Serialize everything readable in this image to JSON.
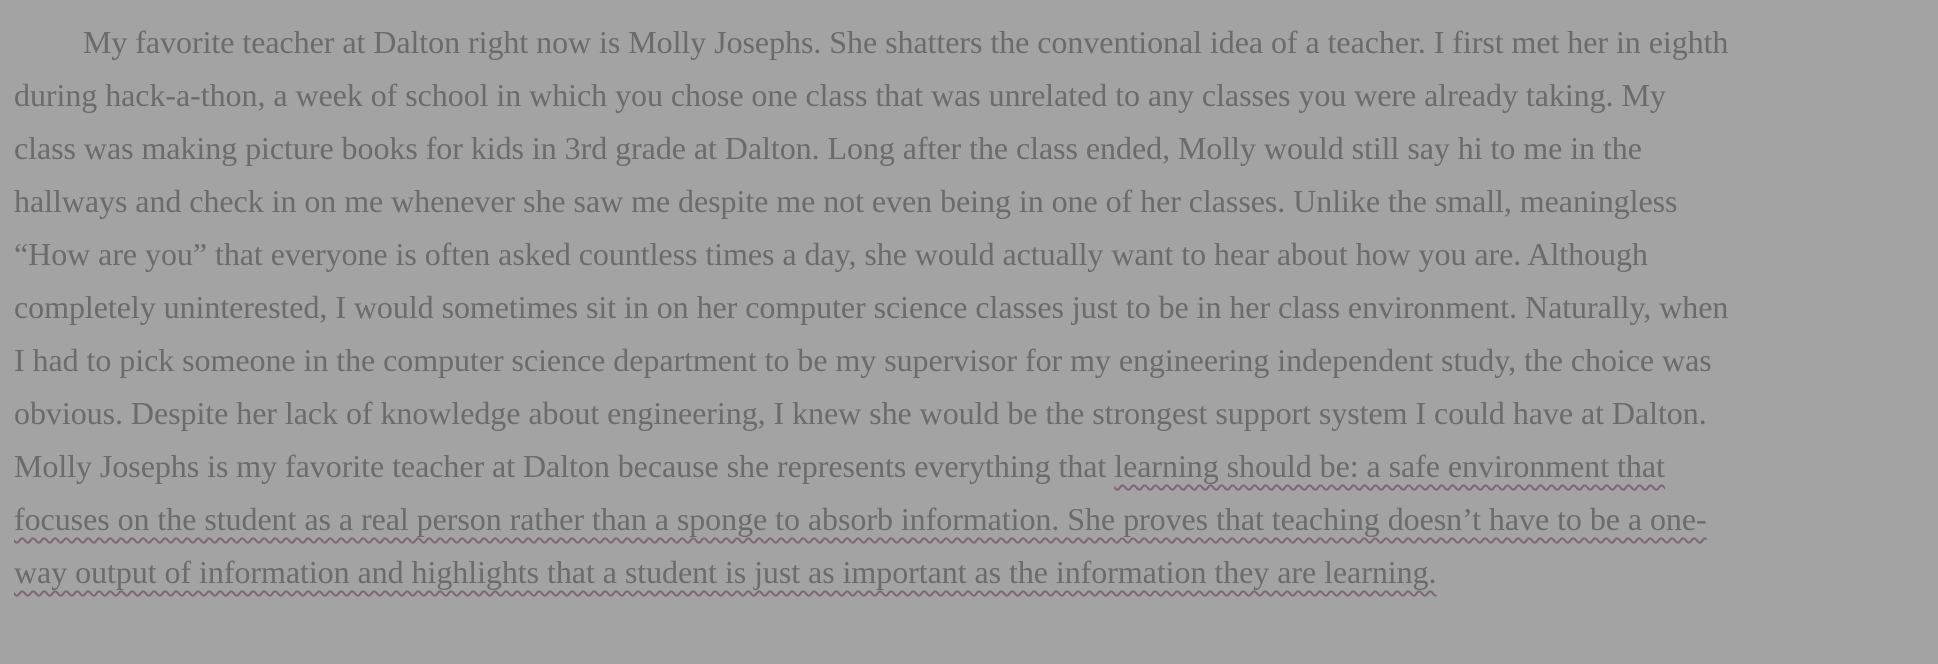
{
  "essay": {
    "lines": [
      "My favorite teacher at Dalton right now is Molly Josephs. She shatters the conventional idea of a teacher. I first met her in eighth",
      "during hack-a-thon, a week of school in which you chose one class that was unrelated to any classes you were already taking. My",
      "class was making picture books for kids in 3rd grade at Dalton. Long after the class ended, Molly would still say hi to me in the",
      "hallways and check in on me whenever she saw me despite me not even being in one of her classes. Unlike the small, meaningless",
      "“How are you” that everyone is often asked countless times a day, she would actually want to hear about how you are. Although",
      "completely uninterested, I would sometimes sit in on her computer science classes just to be in her class environment. Naturally, when",
      "I had to pick someone in the computer science department to be my supervisor for my engineering independent study, the choice was",
      "obvious. Despite her lack of knowledge about engineering, I knew she would be the strongest support system I could have at Dalton."
    ],
    "line9_plain": "Molly Josephs is my favorite teacher at Dalton because she represents everything that ",
    "line9_highlight": "learning should be: a safe environment that",
    "line10_highlight": "focuses on the student as a real person rather than a sponge to absorb information. She proves that teaching doesn’t have to be a one-",
    "line11_highlight": "way output of information and highlights that a student is just as important as the information they are learning."
  },
  "colors": {
    "background": "#a3a3a3",
    "text": "#6b6b6b",
    "underline": "#7e6679"
  }
}
